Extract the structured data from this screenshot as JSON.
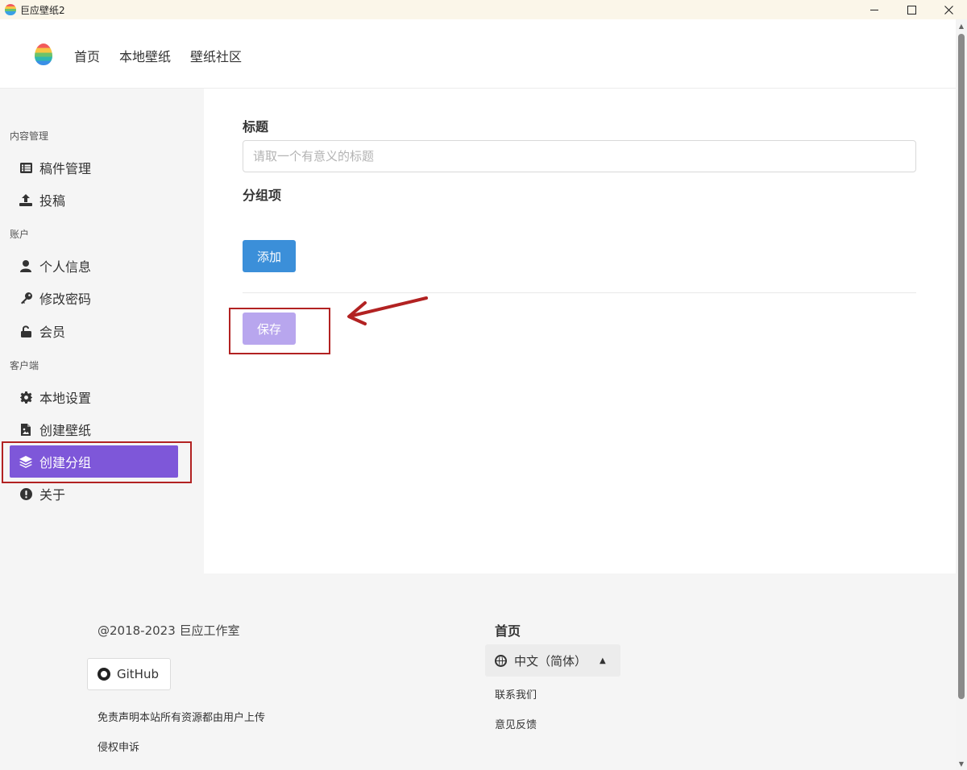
{
  "window": {
    "title": "巨应壁纸2"
  },
  "header": {
    "nav": [
      {
        "label": "首页"
      },
      {
        "label": "本地壁纸"
      },
      {
        "label": "壁纸社区"
      }
    ]
  },
  "sidebar": {
    "sections": [
      {
        "label": "内容管理"
      },
      {
        "label": "账户"
      },
      {
        "label": "客户端"
      }
    ],
    "items": [
      {
        "label": "稿件管理",
        "icon": "list-icon"
      },
      {
        "label": "投稿",
        "icon": "upload-icon"
      },
      {
        "label": "个人信息",
        "icon": "user-icon"
      },
      {
        "label": "修改密码",
        "icon": "key-icon"
      },
      {
        "label": "会员",
        "icon": "unlock-icon"
      },
      {
        "label": "本地设置",
        "icon": "gear-icon"
      },
      {
        "label": "创建壁纸",
        "icon": "file-image-icon"
      },
      {
        "label": "创建分组",
        "icon": "layers-icon",
        "active": true
      },
      {
        "label": "关于",
        "icon": "exclamation-circle-icon"
      }
    ],
    "active_color": "#7e57d9"
  },
  "form": {
    "title_label": "标题",
    "title_placeholder": "请取一个有意义的标题",
    "title_value": "",
    "group_label": "分组项",
    "add_label": "添加",
    "save_label": "保存",
    "add_color": "#3b8fd9",
    "save_color": "#b8a6ee"
  },
  "annotations": {
    "color": "#b22222"
  },
  "footer": {
    "copyright": "@2018-2023 巨应工作室",
    "github_label": "GitHub",
    "disclaimer": "免责声明本站所有资源都由用户上传",
    "infringement": "侵权申诉",
    "home_label": "首页",
    "language": "中文（简体）",
    "contact": "联系我们",
    "feedback": "意见反馈"
  }
}
